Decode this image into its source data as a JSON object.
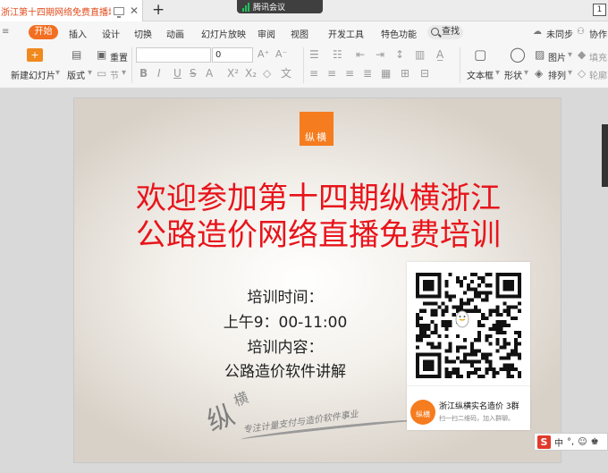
{
  "tabbar": {
    "doc_title": "浙江第十四期网络免费直播培训",
    "close_glyph": "✕",
    "new_tab_glyph": "+",
    "meeting_label": "腾讯会议",
    "page_badge": "1"
  },
  "menu": {
    "left_glyph": "≡",
    "start": "开始",
    "items": [
      "插入",
      "设计",
      "切换",
      "动画",
      "幻灯片放映",
      "审阅",
      "视图",
      "开发工具",
      "特色功能"
    ],
    "search_label": "查找",
    "unsynced": "未同步",
    "collab": "协作"
  },
  "toolbar": {
    "new_slide": "新建幻灯片",
    "layout": "版式",
    "reset": "重置",
    "section": "节",
    "font_size_value": "0",
    "text_box": "文本框",
    "shapes": "形状",
    "picture": "图片",
    "arrange": "排列",
    "fill": "填充",
    "outline": "轮廓",
    "dropdown_glyph": "▾"
  },
  "slide": {
    "logo_text": "纵横",
    "title_line_1": "欢迎参加第十四期纵横浙江",
    "title_line_2": "公路造价网络直播免费培训",
    "info_lines": [
      "培训时间：",
      "上午9：00-11:00",
      "培训内容：",
      "公路造价软件讲解"
    ],
    "watermark_zong": "纵",
    "watermark_heng": "横",
    "watermark_slogan": "专注计量支付与造价软件事业"
  },
  "qr_card": {
    "group_name": "浙江纵横实名造价 3群",
    "hint": "扫一扫二维码，加入群聊。",
    "avatar_text": "纵横"
  },
  "ime": {
    "logo": "S",
    "lang": "中",
    "punct": "°,",
    "emoji": "☺",
    "extra": "♚"
  },
  "colors": {
    "accent_orange": "#f26f21",
    "title_red": "#e8141b",
    "logo_orange": "#f57c1f"
  }
}
